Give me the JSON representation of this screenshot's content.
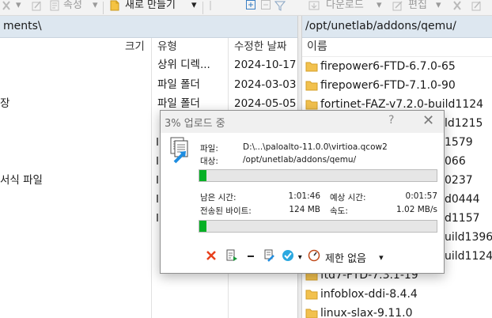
{
  "toolbar": {
    "properties_label": "속성",
    "new_label": "새로 만들기",
    "download_label": "다운로드",
    "edit_label": "편집"
  },
  "left_pane": {
    "path": "ments\\",
    "columns": {
      "size": "크기",
      "type": "유형",
      "modified": "수정한 날짜"
    },
    "rows": [
      {
        "name": "",
        "type": "상위 디렉...",
        "modified": "2024-10-17"
      },
      {
        "name": "",
        "type": "파일 폴더",
        "modified": "2024-03-03"
      },
      {
        "name": "장",
        "type": "파일 폴더",
        "modified": "2024-05-05"
      }
    ],
    "row_fragment": "서식 파일",
    "type_fragment": "I"
  },
  "right_pane": {
    "path": "/opt/unetlab/addons/qemu/",
    "column_name": "이름",
    "items": [
      "firepower6-FTD-6.7.0-65",
      "firepower6-FTD-7.1.0-90",
      "fortinet-FAZ-v7.2.0-build1124",
      "",
      "",
      "",
      "",
      "",
      "",
      "",
      "",
      "ftd7-FTD-7.3.1-19",
      "infoblox-ddi-8.4.4",
      "linux-slax-9.11.0"
    ],
    "suffixes": [
      "ld1215",
      "1579",
      "066",
      "0237",
      "d0444",
      "d1157",
      "uild1396",
      "uild1124"
    ]
  },
  "dialog": {
    "title": "3% 업로드 중",
    "help": "?",
    "close": "✕",
    "file_label": "파일:",
    "file_value": "D:\\...\\paloalto-11.0.0\\virtioa.qcow2",
    "target_label": "대상:",
    "target_value": "/opt/unetlab/addons/qemu/",
    "file_progress": 0.03,
    "remaining_label": "남은 시간:",
    "remaining_value": "1:01:46",
    "estimated_label": "예상 시간:",
    "estimated_value": "0:01:57",
    "transferred_label": "전송된 바이트:",
    "transferred_value": "124 MB",
    "speed_label": "속도:",
    "speed_value": "1.02 MB/s",
    "total_progress": 0.03,
    "limit_label": "제한 없음"
  }
}
